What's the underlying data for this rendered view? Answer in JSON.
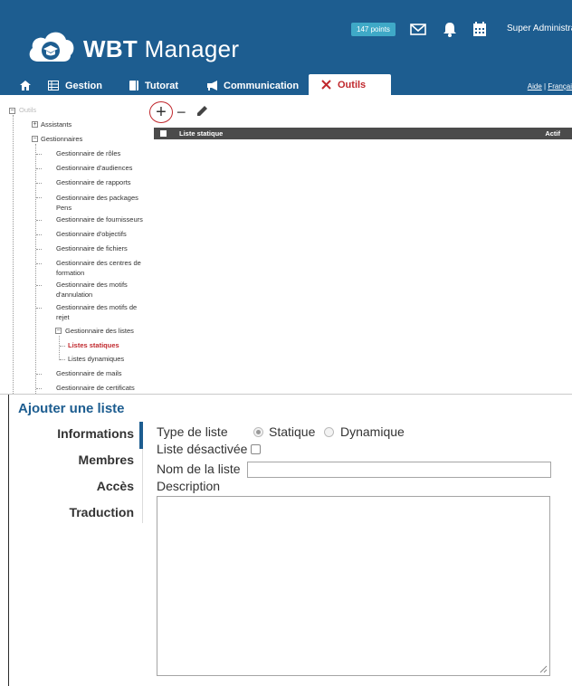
{
  "header": {
    "logo_bold": "WBT",
    "logo_rest": " Manager",
    "points": "147 points",
    "user": "Super Administrato"
  },
  "nav": {
    "items": [
      {
        "label": "",
        "icon": "home-icon"
      },
      {
        "label": "Gestion",
        "icon": "table-icon"
      },
      {
        "label": "Tutorat",
        "icon": "book-icon"
      },
      {
        "label": "Communication",
        "icon": "megaphone-icon"
      },
      {
        "label": "Outils",
        "icon": "tools-icon",
        "active": true
      }
    ],
    "help": "Aide",
    "separator": "|",
    "language": "Françai"
  },
  "tree": {
    "root": "Outils",
    "assistants": "Assistants",
    "gestionnaires": "Gestionnaires",
    "items": [
      "Gestionnaire de rôles",
      "Gestionnaire d'audiences",
      "Gestionnaire de rapports",
      "Gestionnaire des packages Pens",
      "Gestionnaire de fournisseurs",
      "Gestionnaire d'objectifs",
      "Gestionnaire de fichiers",
      "Gestionnaire des centres de formation",
      "Gestionnaire des motifs d'annulation",
      "Gestionnaire des motifs de rejet",
      "Gestionnaire des listes",
      "Listes statiques",
      "Listes dynamiques",
      "Gestionnaire de mails",
      "Gestionnaire de certificats"
    ]
  },
  "grid": {
    "col_name": "Liste statique",
    "col_active": "Actif"
  },
  "form": {
    "title": "Ajouter une liste",
    "tabs": [
      "Informations",
      "Membres",
      "Accès",
      "Traduction"
    ],
    "type_label": "Type de liste",
    "type_options": [
      "Statique",
      "Dynamique"
    ],
    "type_selected": "Statique",
    "disabled_label": "Liste désactivée",
    "disabled_checked": false,
    "name_label": "Nom de la liste",
    "name_value": "",
    "description_label": "Description",
    "description_value": ""
  },
  "colors": {
    "header_bg": "#1d5d90",
    "accent_red": "#c0282d",
    "grid_header": "#4b4b4b",
    "badge": "#3fa9c7"
  }
}
